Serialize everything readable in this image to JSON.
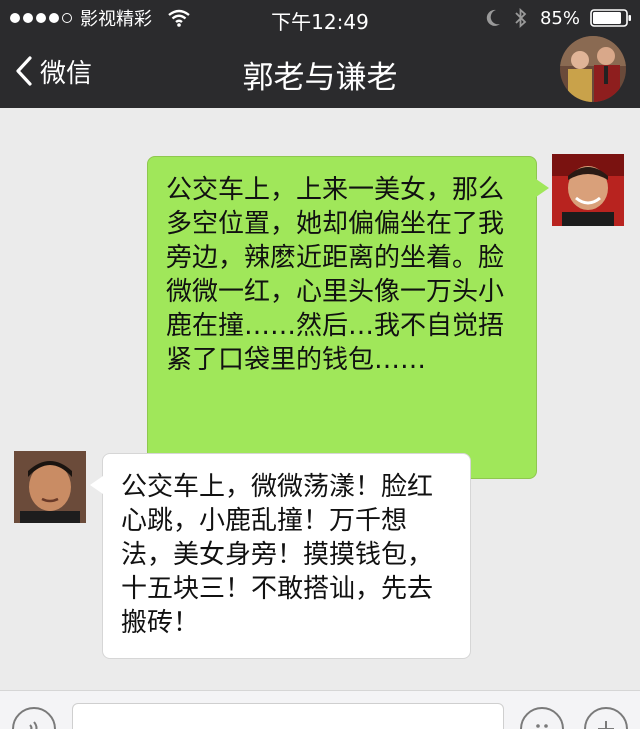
{
  "status_bar": {
    "carrier": "影视精彩",
    "time": "下午12:49",
    "battery": "85%",
    "icons": [
      "signal-dots-icon",
      "wifi-icon",
      "moon-icon",
      "bluetooth-icon",
      "battery-icon"
    ]
  },
  "nav": {
    "back_label": "微信",
    "title": "郭老与谦老",
    "icons": [
      "back-chevron-icon",
      "group-avatar"
    ]
  },
  "messages": [
    {
      "direction": "out",
      "text": "公交车上，上来一美女，那么多空位置，她却偏偏坐在了我旁边，辣麽近距离的坐着。脸微微一红，心里头像一万头小鹿在撞……然后…我不自觉捂紧了口袋里的钱包……"
    },
    {
      "direction": "in",
      "text": "公交车上，微微荡漾！脸红心跳，小鹿乱撞！万千想法，美女身旁！摸摸钱包，十五块三！不敢搭讪，先去搬砖！"
    }
  ],
  "colors": {
    "bar_bg": "#2b2b2d",
    "chat_bg": "#ebebeb",
    "outgoing_bubble": "#a0e75a",
    "incoming_bubble": "#ffffff"
  },
  "input_bar": {
    "icons": [
      "voice-icon",
      "emoji-icon",
      "plus-icon"
    ]
  }
}
